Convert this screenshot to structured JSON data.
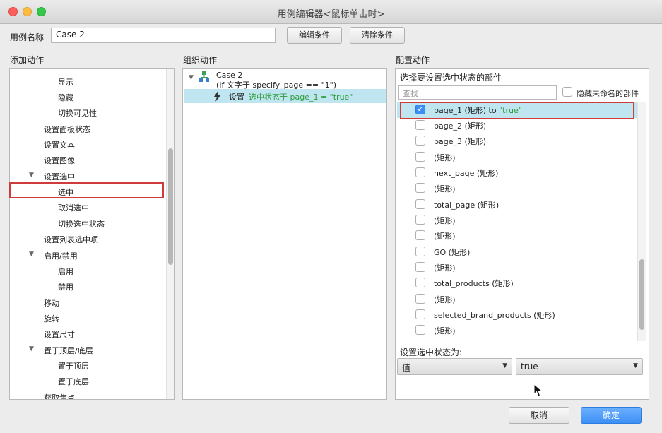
{
  "window": {
    "title": "用例编辑器<鼠标单击时>"
  },
  "case_name": {
    "label": "用例名称",
    "value": "Case 2"
  },
  "buttons": {
    "edit_condition": "编辑条件",
    "clear_condition": "清除条件",
    "cancel": "取消",
    "ok": "确定"
  },
  "add_actions": {
    "header": "添加动作",
    "items": [
      "显示",
      "隐藏",
      "切换可见性",
      "设置面板状态",
      "设置文本",
      "设置图像",
      "设置选中",
      "选中",
      "取消选中",
      "切换选中状态",
      "设置列表选中项",
      "启用/禁用",
      "启用",
      "禁用",
      "移动",
      "旋转",
      "设置尺寸",
      "置于顶层/底层",
      "置于顶层",
      "置于底层",
      "获取焦点"
    ]
  },
  "organize_actions": {
    "header": "组织动作",
    "case_title": "Case 2",
    "case_condition": "(If 文字于 specify_page == \"1\")",
    "action_prefix": "设置",
    "action_text": "选中状态于 page_1 = \"true\""
  },
  "configure_actions": {
    "header": "配置动作",
    "select_label": "选择要设置选中状态的部件",
    "search_placeholder": "查找",
    "hide_unnamed_label": "隐藏未命名的部件",
    "widgets": [
      {
        "name": "page_1 (矩形)",
        "suffix": " to ",
        "value": "\"true\"",
        "checked": true
      },
      {
        "name": "page_2 (矩形)",
        "checked": false
      },
      {
        "name": "page_3 (矩形)",
        "checked": false
      },
      {
        "name": "(矩形)",
        "checked": false
      },
      {
        "name": "next_page (矩形)",
        "checked": false
      },
      {
        "name": "(矩形)",
        "checked": false
      },
      {
        "name": "total_page (矩形)",
        "checked": false
      },
      {
        "name": "(矩形)",
        "checked": false
      },
      {
        "name": "(矩形)",
        "checked": false
      },
      {
        "name": "GO (矩形)",
        "checked": false
      },
      {
        "name": "(矩形)",
        "checked": false
      },
      {
        "name": "total_products (矩形)",
        "checked": false
      },
      {
        "name": "(矩形)",
        "checked": false
      },
      {
        "name": "selected_brand_products (矩形)",
        "checked": false
      },
      {
        "name": "(矩形)",
        "checked": false
      }
    ],
    "set_state_label": "设置选中状态为:",
    "value_type": "值",
    "value": "true"
  },
  "colors": {
    "highlight_row": "#bfe6f0",
    "green_text": "#2e9c3a",
    "primary_button": "#3d8ff5",
    "red_box": "#d03c3c"
  }
}
